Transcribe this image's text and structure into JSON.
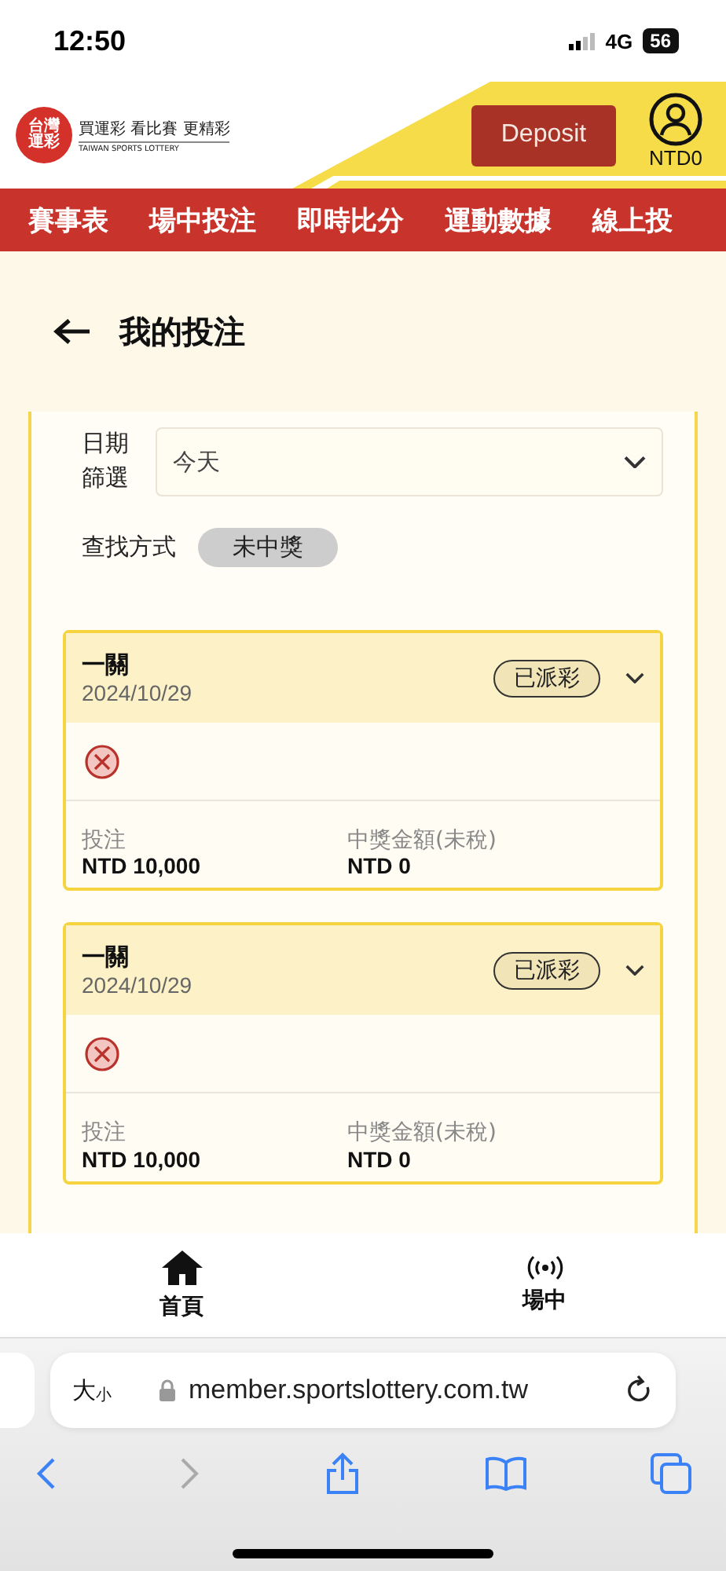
{
  "status_bar": {
    "time": "12:50",
    "network": "4G",
    "battery": "56"
  },
  "header": {
    "logo_mark_top": "台灣",
    "logo_mark_bottom": "運彩",
    "tagline": "買運彩 看比賽 更精彩",
    "logo_english": "TAIWAN SPORTS LOTTERY",
    "deposit_button": "Deposit",
    "balance": "NTD0"
  },
  "nav": {
    "items": [
      {
        "label": "賽事表"
      },
      {
        "label": "場中投注"
      },
      {
        "label": "即時比分"
      },
      {
        "label": "運動數據"
      },
      {
        "label": "線上投"
      }
    ]
  },
  "page_title": "我的投注",
  "filters": {
    "date_label": "日期篩選",
    "date_value": "今天",
    "search_label": "查找方式",
    "search_chip": "未中獎"
  },
  "bets": [
    {
      "title": "一關",
      "date": "2024/10/29",
      "status": "已派彩",
      "stake_label": "投注",
      "stake": "NTD 10,000",
      "prize_label": "中獎金額(未稅)",
      "prize": "NTD 0"
    },
    {
      "title": "一關",
      "date": "2024/10/29",
      "status": "已派彩",
      "stake_label": "投注",
      "stake": "NTD 10,000",
      "prize_label": "中獎金額(未稅)",
      "prize": "NTD 0"
    }
  ],
  "bottom_tabs": [
    {
      "kind": "home",
      "label": "首頁"
    },
    {
      "kind": "live",
      "label": "場中"
    }
  ],
  "browser": {
    "aa_large": "大",
    "aa_small": "小",
    "url": "member.sportslottery.com.tw"
  }
}
